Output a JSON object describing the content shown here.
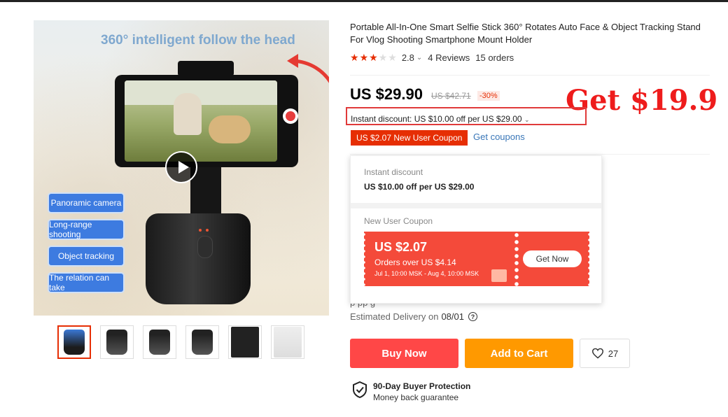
{
  "gallery": {
    "headline": "360° intelligent follow the head",
    "features": [
      "Panoramic camera",
      "Long-range shooting",
      "Object tracking",
      "The relation can take"
    ],
    "thumbnails": [
      "thumb-1",
      "thumb-2",
      "thumb-3",
      "thumb-4",
      "thumb-5",
      "thumb-6"
    ],
    "active_thumbnail": 0
  },
  "product": {
    "title": "Portable All-In-One Smart Selfie Stick 360° Rotates Auto Face & Object Tracking Stand For Vlog Shooting Smartphone Mount Holder",
    "rating_value": "2.8",
    "rating_stars": 3,
    "reviews": "4 Reviews",
    "orders": "15 orders"
  },
  "pricing": {
    "price": "US $29.90",
    "original_price": "US $42.71",
    "discount": "-30%",
    "promo_overlay": "Get $19.9",
    "instant_discount_text": "Instant discount: US $10.00 off per US $29.00",
    "coupon_tag": "US $2.07 New User Coupon",
    "get_coupons": "Get coupons",
    "accent_color": "#e62e04"
  },
  "popup": {
    "instant_label": "Instant discount",
    "instant_value": "US $10.00 off per US $29.00",
    "coupon_label": "New User Coupon",
    "coupon_amount": "US $2.07",
    "coupon_min": "Orders over US $4.14",
    "coupon_validity": "Jul 1, 10:00 MSK - Aug 4, 10:00 MSK",
    "coupon_button": "Get Now"
  },
  "shipping": {
    "hidden_text": "p                                                                pp g",
    "delivery_label": "Estimated Delivery on",
    "delivery_date": "08/01"
  },
  "actions": {
    "buy_now": "Buy Now",
    "add_to_cart": "Add to Cart",
    "wishlist_count": "27"
  },
  "protection": {
    "title": "90-Day Buyer Protection",
    "subtitle": "Money back guarantee"
  }
}
